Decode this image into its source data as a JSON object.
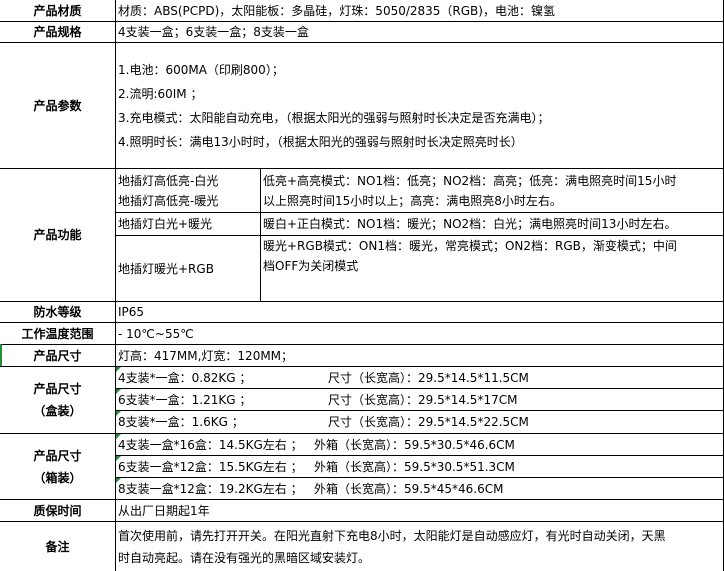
{
  "rows": {
    "material": {
      "label": "产品材质",
      "value": "材质：ABS(PCPD)，太阳能板：多晶硅，灯珠：5050/2835（RGB)，电池：镍氢"
    },
    "spec": {
      "label": "产品规格",
      "value": "4支装一盒；6支装一盒；8支装一盒"
    },
    "params": {
      "label": "产品参数",
      "lines": [
        "1.电池：600MA（印刷800）；",
        "2.流明:60IM ；",
        "3.充电模式：太阳能自动充电，（根据太阳光的强弱与照射时长决定是否充满电）；",
        "4.照明时长：满电13小时时，（根据太阳光的强弱与照射时长决定照亮时长）"
      ]
    },
    "function": {
      "label": "产品功能",
      "left": [
        [
          "地插灯高低亮-白光",
          "地插灯高低亮-暖光"
        ],
        [
          "地插灯白光+暖光"
        ],
        [
          "地插灯暖光+RGB"
        ]
      ],
      "right": [
        [
          "低亮+高亮模式：NO1档：低亮；NO2档：高亮；低亮：满电照亮时间15小时",
          "以上照亮时间15小时以上；高亮：满电照亮8小时左右。"
        ],
        [
          "暖白+正白模式：NO1档：暖光；NO2档：白光；满电照亮时间13小时左右。"
        ],
        [
          "暖光+RGB模式：ON1档：暖光，常亮模式；ON2档：RGB，渐变模式；中间",
          "档OFF为关闭模式"
        ]
      ]
    },
    "waterproof": {
      "label": "防水等级",
      "value": "IP65"
    },
    "temperature": {
      "label": "工作温度范围",
      "value": "- 10℃~55℃"
    },
    "size": {
      "label": "产品尺寸",
      "value": "灯高：417MM,灯宽：120MM；"
    },
    "box": {
      "label_top": "产品尺寸",
      "label_bottom": "（盒装）",
      "rows": [
        {
          "weight": "4支装*一盒：0.82KG   ；",
          "size": "尺寸（长宽高）：29.5*14.5*11.5CM"
        },
        {
          "weight": "6支装*一盒：1.21KG   ；",
          "size": "尺寸（长宽高）：29.5*14.5*17CM"
        },
        {
          "weight": "8支装*一盒：1.6KG    ；",
          "size": "尺寸（长宽高）：29.5*14.5*22.5CM"
        }
      ]
    },
    "carton": {
      "label_top": "产品尺寸",
      "label_bottom": "（箱装）",
      "rows": [
        {
          "weight": "4支装一盒*16盒：14.5KG左右  ；",
          "size": "外箱（长宽高）：59.5*30.5*46.6CM"
        },
        {
          "weight": "6支装一盒*12盒：15.5KG左右  ；",
          "size": "外箱（长宽高）：59.5*30.5*51.3CM"
        },
        {
          "weight": "8支装一盒*12盒：19.2KG左右  ；",
          "size": "外箱（长宽高）：59.5*45*46.6CM"
        }
      ]
    },
    "warranty": {
      "label": "质保时间",
      "value": "从出厂日期起1年"
    },
    "notes": {
      "label": "备注",
      "lines": [
        "首次使用前，请先打开开关。在阳光直射下充电8小时，太阳能灯是自动感应灯，有光时自动关闭，天黑",
        "时自动亮起。请在没有强光的黑暗区域安装灯。"
      ]
    }
  },
  "colors": {
    "grid": "#000000",
    "marker": "#1f8f3a"
  }
}
